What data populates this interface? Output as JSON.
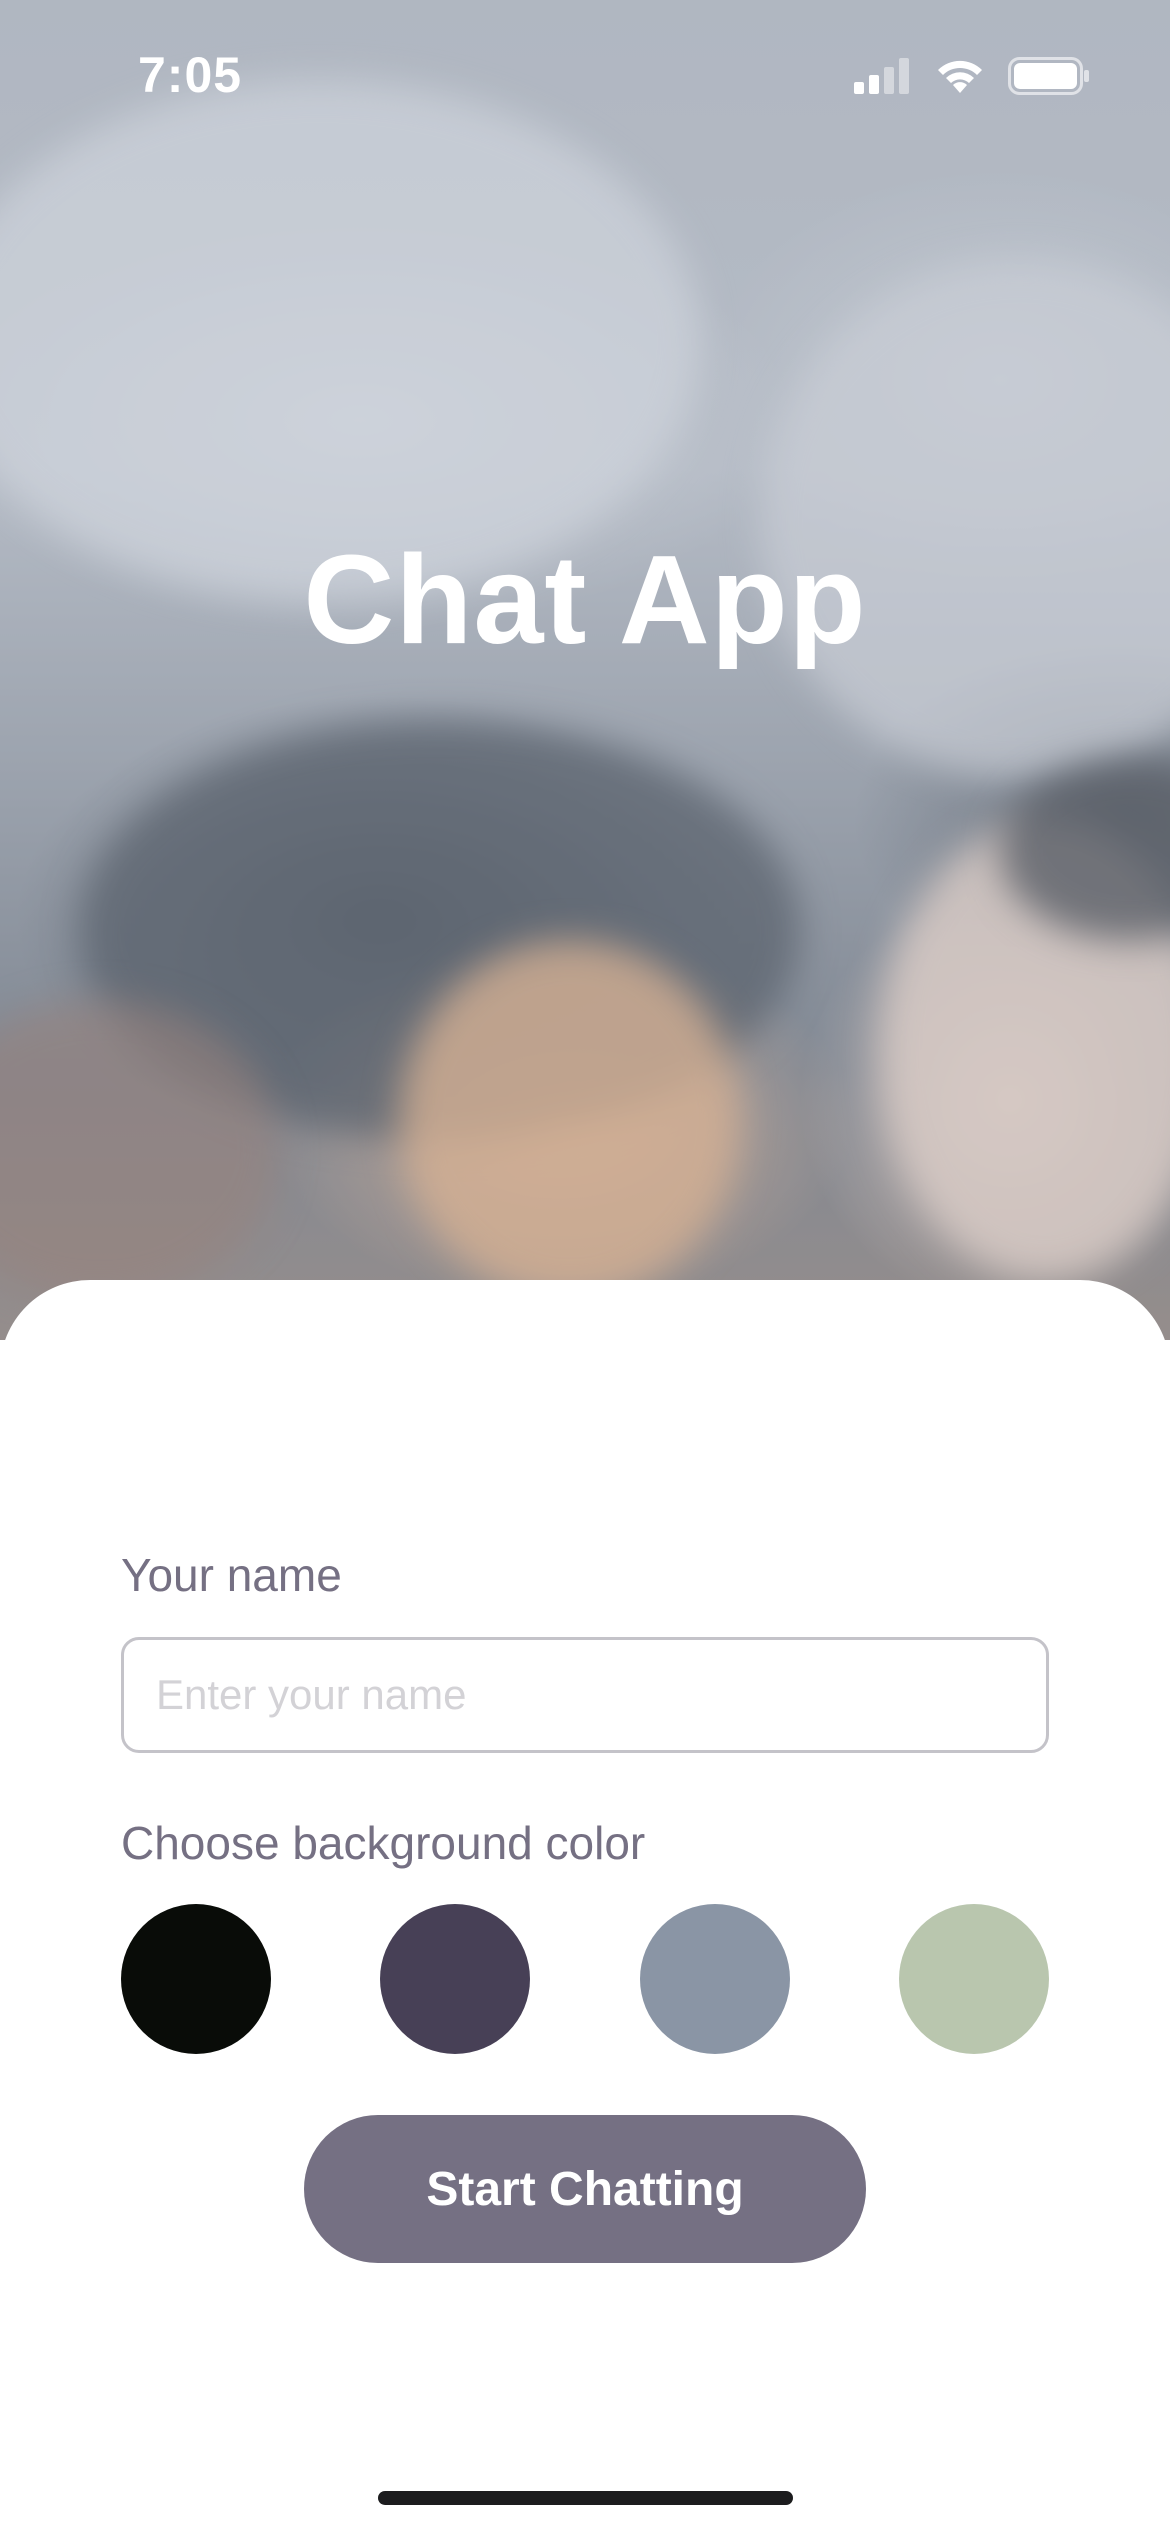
{
  "status_bar": {
    "time": "7:05",
    "icons": [
      "cellular-signal-icon",
      "wifi-icon",
      "battery-icon"
    ]
  },
  "app": {
    "title": "Chat App"
  },
  "form": {
    "name_label": "Your name",
    "name_placeholder": "Enter your name",
    "name_value": "",
    "color_label": "Choose background color",
    "colors": [
      "#090C08",
      "#474056",
      "#8A95A5",
      "#B9C6AE"
    ],
    "start_button_label": "Start Chatting"
  },
  "theme": {
    "accent": "#757083",
    "text_secondary": "#757083",
    "sheet_background": "#FFFFFF"
  }
}
